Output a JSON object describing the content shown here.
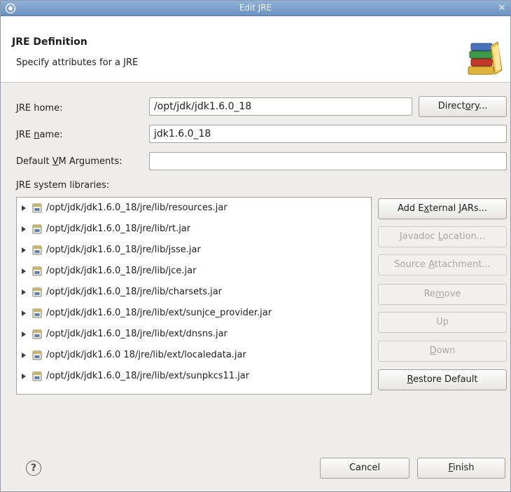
{
  "window": {
    "title": "Edit JRE",
    "close_glyph": "×",
    "app_icon": "eclipse-icon"
  },
  "header": {
    "title": "JRE Definition",
    "description": "Specify attributes for a JRE",
    "icon": "library-books-icon"
  },
  "form": {
    "jre_home": {
      "label_pre": "",
      "label_mnemonic": "J",
      "label_post": "RE home:",
      "value": "/opt/jdk/jdk1.6.0_18"
    },
    "directory_button": {
      "pre": "Direct",
      "mnemonic": "o",
      "post": "ry..."
    },
    "jre_name": {
      "label_pre": "JRE ",
      "label_mnemonic": "n",
      "label_post": "ame:",
      "value": "jdk1.6.0_18"
    },
    "vm_args": {
      "label_pre": "Default ",
      "label_mnemonic": "V",
      "label_post": "M Arguments:",
      "value": ""
    },
    "system_libraries_label": "JRE system libraries:"
  },
  "libraries": [
    "/opt/jdk/jdk1.6.0_18/jre/lib/resources.jar",
    "/opt/jdk/jdk1.6.0_18/jre/lib/rt.jar",
    "/opt/jdk/jdk1.6.0_18/jre/lib/jsse.jar",
    "/opt/jdk/jdk1.6.0_18/jre/lib/jce.jar",
    "/opt/jdk/jdk1.6.0_18/jre/lib/charsets.jar",
    "/opt/jdk/jdk1.6.0_18/jre/lib/ext/sunjce_provider.jar",
    "/opt/jdk/jdk1.6.0_18/jre/lib/ext/dnsns.jar",
    "/opt/jdk/jdk1.6.0 18/jre/lib/ext/localedata.jar",
    "/opt/jdk/jdk1.6.0_18/jre/lib/ext/sunpkcs11.jar"
  ],
  "side_buttons": {
    "add_external_jars": {
      "pre": "Add E",
      "mnemonic": "x",
      "post": "ternal JARs..."
    },
    "javadoc_location": {
      "pre": "Javadoc ",
      "mnemonic": "L",
      "post": "ocation..."
    },
    "source_attachment": {
      "pre": "Source ",
      "mnemonic": "A",
      "post": "ttachment..."
    },
    "remove": {
      "pre": "Re",
      "mnemonic": "m",
      "post": "ove"
    },
    "up": {
      "pre": "",
      "mnemonic": "",
      "post": "Up"
    },
    "down": {
      "pre": "",
      "mnemonic": "D",
      "post": "own"
    },
    "restore_default": {
      "pre": "",
      "mnemonic": "R",
      "post": "estore Default"
    }
  },
  "footer": {
    "help_glyph": "?",
    "cancel": {
      "pre": "Cancel",
      "mnemonic": "",
      "post": ""
    },
    "finish": {
      "pre": "",
      "mnemonic": "F",
      "post": "inish"
    }
  }
}
